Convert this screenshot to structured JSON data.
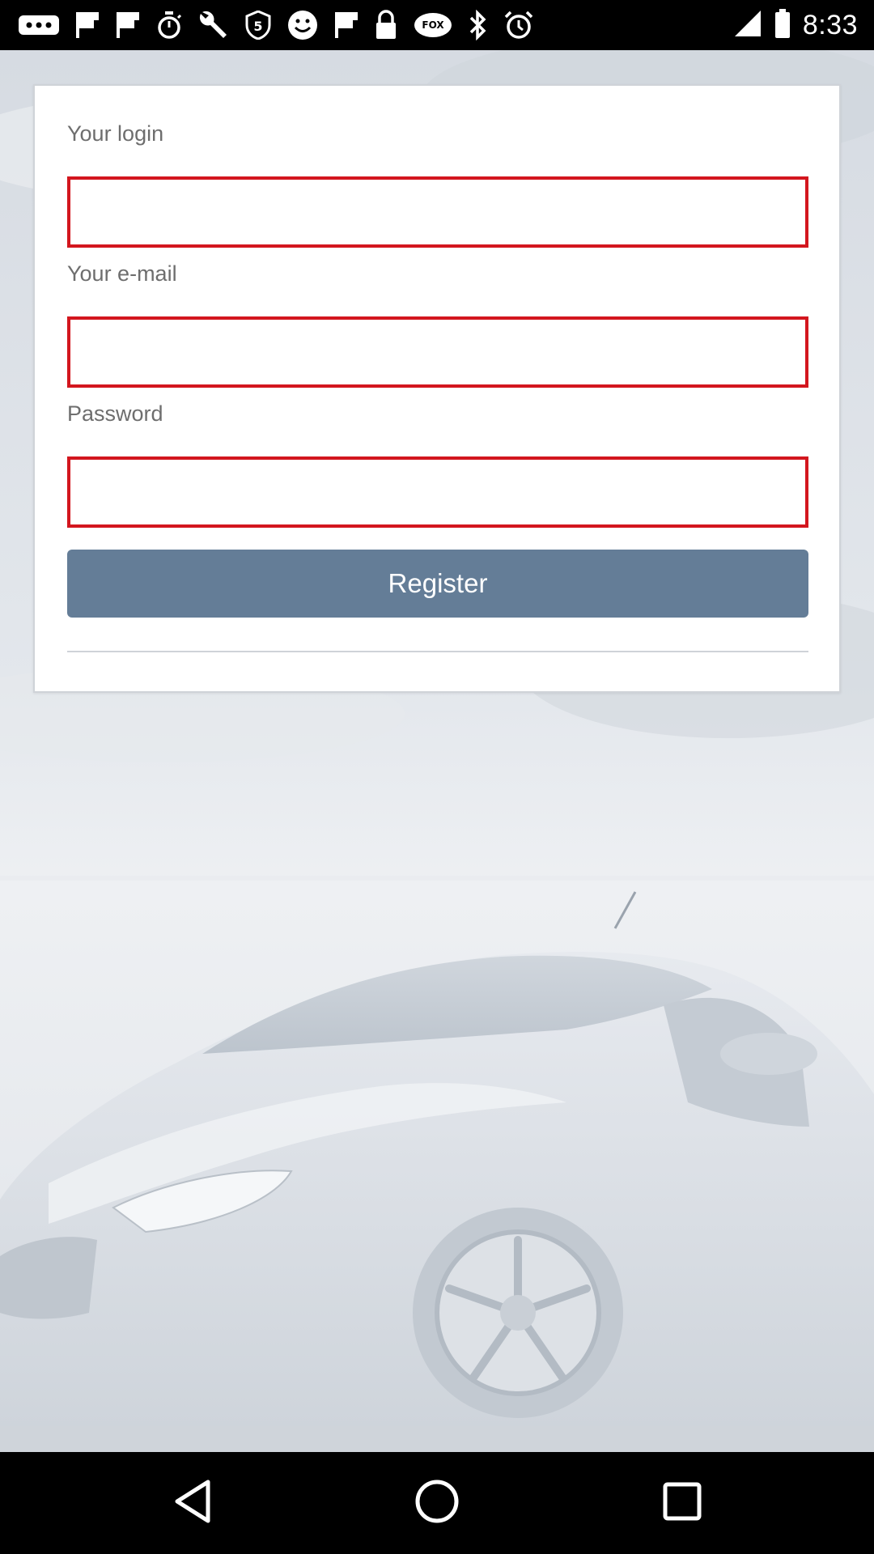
{
  "status_bar": {
    "time": "8:33",
    "icons": [
      "more-icon",
      "flipboard-icon",
      "flipboard-icon",
      "stopwatch-icon",
      "wrench-icon",
      "five-app-icon",
      "smiley-icon",
      "flipboard-icon",
      "lock-icon",
      "fox-sports-icon",
      "bluetooth-icon",
      "alarm-icon"
    ]
  },
  "form": {
    "login_label": "Your login",
    "email_label": "Your e-mail",
    "password_label": "Password",
    "login_value": "",
    "email_value": "",
    "password_value": "",
    "register_label": "Register"
  },
  "colors": {
    "input_border": "#d3161e",
    "button_bg": "#647d97",
    "button_text": "#ffffff",
    "label_text": "#6e6e6e"
  },
  "nav_bar": {
    "icons": [
      "back-icon",
      "home-icon",
      "recents-icon"
    ]
  }
}
